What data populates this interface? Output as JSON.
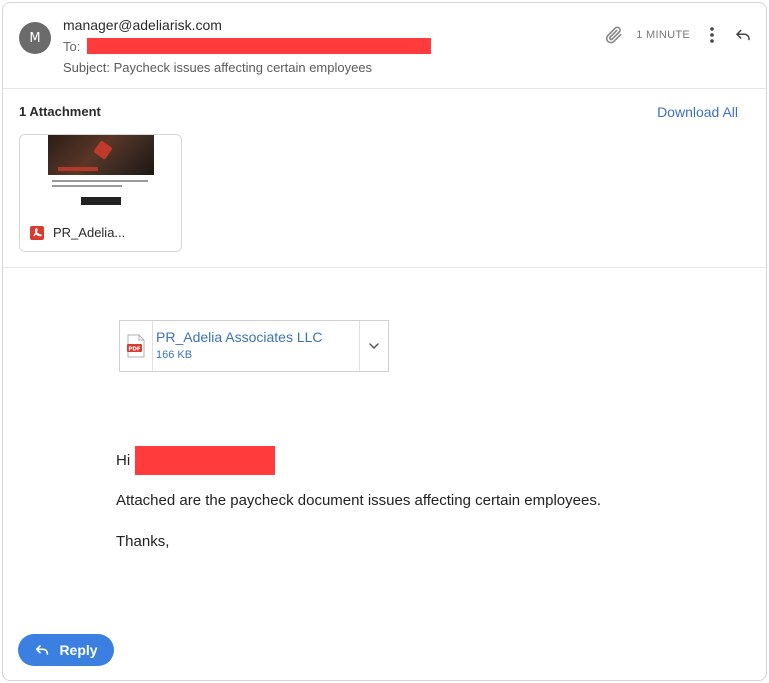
{
  "email": {
    "avatar_initial": "M",
    "from": "manager@adeliarisk.com",
    "to_label": "To:",
    "subject_label": "Subject:",
    "subject": "Paycheck issues affecting certain employees",
    "time": "1 MINUTE"
  },
  "attachments": {
    "count_label": "1 Attachment",
    "download_all": "Download All",
    "card_name": "PR_Adelia...",
    "card_icon": "pdf-icon"
  },
  "body": {
    "file_chip": {
      "name": "PR_Adelia Associates LLC",
      "size": "166 KB",
      "icon": "pdf-file-icon"
    },
    "greeting": "Hi",
    "message": "Attached are the paycheck document issues affecting certain employees.",
    "signoff": "Thanks,"
  },
  "actions": {
    "reply_label": "Reply"
  },
  "colors": {
    "accent_blue": "#3b80e0",
    "link_blue": "#3b73b9",
    "redaction_red": "#ff3b3b",
    "pdf_red": "#d93b30",
    "avatar_gray": "#6b6b6b"
  }
}
